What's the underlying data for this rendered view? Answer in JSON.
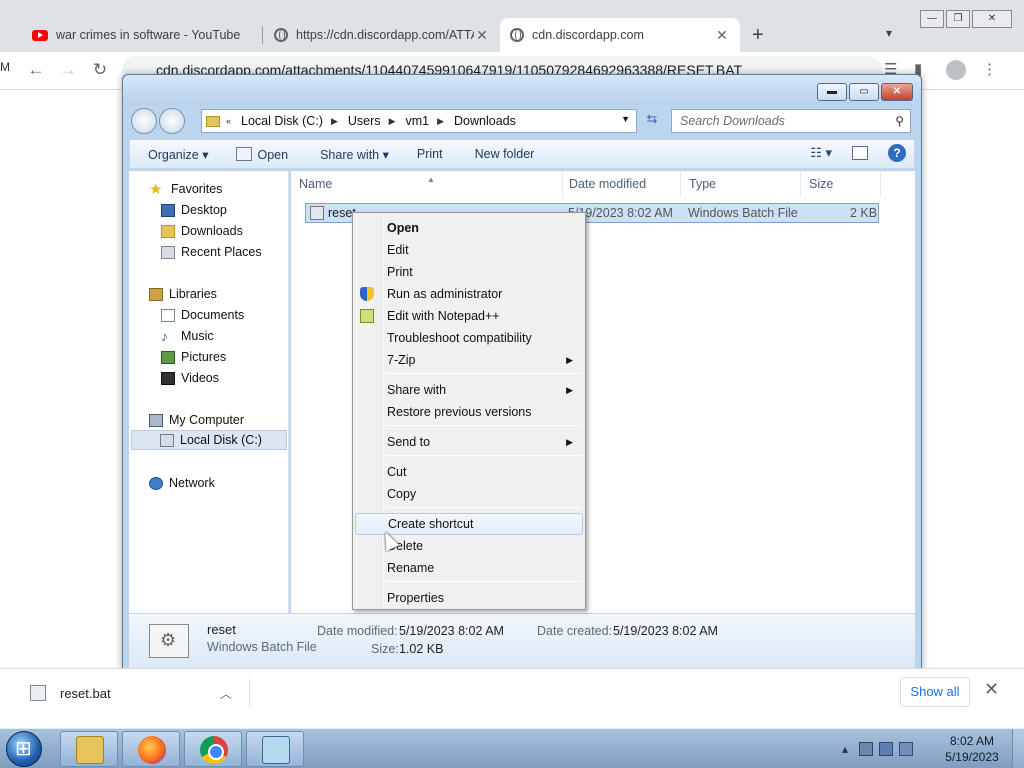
{
  "browser": {
    "tabs": [
      {
        "title": "war crimes in software - YouTube",
        "icon": "youtube-icon"
      },
      {
        "title": "https://cdn.discordapp.com/ATTA",
        "icon": "globe-icon"
      },
      {
        "title": "cdn.discordapp.com",
        "icon": "globe-icon",
        "active": true
      }
    ],
    "address": "cdn.discordapp.com/attachments/1104407459910647919/1105079284692963388/RESET.BAT",
    "left_letter": "M",
    "download": {
      "filename": "reset.bat",
      "show_all": "Show all"
    }
  },
  "explorer": {
    "breadcrumbs": [
      "Local Disk (C:)",
      "Users",
      "vm1",
      "Downloads"
    ],
    "search_placeholder": "Search Downloads",
    "commands": {
      "organize": "Organize",
      "open": "Open",
      "share_with": "Share with",
      "print": "Print",
      "new_folder": "New folder"
    },
    "nav": {
      "favorites": "Favorites",
      "desktop": "Desktop",
      "downloads": "Downloads",
      "recent_places": "Recent Places",
      "libraries": "Libraries",
      "documents": "Documents",
      "music": "Music",
      "pictures": "Pictures",
      "videos": "Videos",
      "my_computer": "My Computer",
      "local_disk": "Local Disk (C:)",
      "network": "Network"
    },
    "columns": {
      "name": "Name",
      "date_modified": "Date modified",
      "type": "Type",
      "size": "Size"
    },
    "file": {
      "name": "reset",
      "date_modified": "5/19/2023 8:02 AM",
      "type": "Windows Batch File",
      "size": "2 KB"
    },
    "details": {
      "name": "reset",
      "type": "Windows Batch File",
      "date_modified_label": "Date modified:",
      "date_modified": "5/19/2023 8:02 AM",
      "date_created_label": "Date created:",
      "date_created": "5/19/2023 8:02 AM",
      "size_label": "Size:",
      "size": "1.02 KB"
    }
  },
  "context_menu": {
    "open": "Open",
    "edit": "Edit",
    "print": "Print",
    "run_as_admin": "Run as administrator",
    "edit_notepadpp": "Edit with Notepad++",
    "troubleshoot": "Troubleshoot compatibility",
    "seven_zip": "7-Zip",
    "share_with": "Share with",
    "restore": "Restore previous versions",
    "send_to": "Send to",
    "cut": "Cut",
    "copy": "Copy",
    "create_shortcut": "Create shortcut",
    "delete": "Delete",
    "rename": "Rename",
    "properties": "Properties"
  },
  "taskbar": {
    "time": "8:02 AM",
    "date": "5/19/2023"
  }
}
